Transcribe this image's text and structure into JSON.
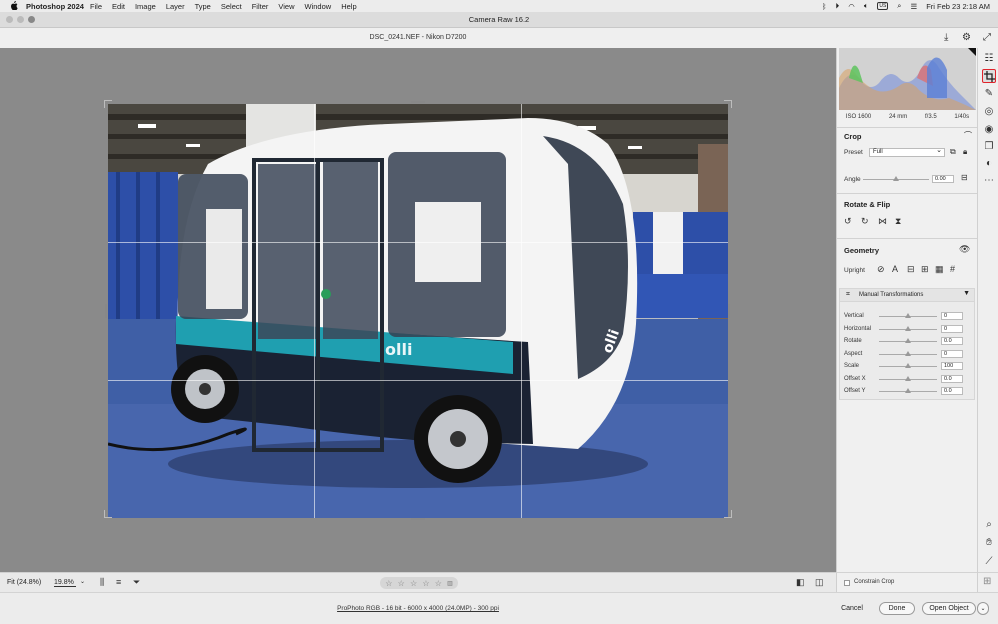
{
  "menubar": {
    "apple": "",
    "app_name": "Photoshop 2024",
    "items": [
      "File",
      "Edit",
      "Image",
      "Layer",
      "Type",
      "Select",
      "Filter",
      "View",
      "Window",
      "Help"
    ],
    "input_source": "US",
    "datetime": "Fri Feb 23  2:18 AM"
  },
  "window": {
    "title": "Camera Raw 16.2"
  },
  "filebar": {
    "filename": "DSC_0241.NEF  -  Nikon D7200"
  },
  "histogram": {
    "iso": "ISO 1600",
    "focal": "24 mm",
    "aperture": "f/3.5",
    "shutter": "1/40s",
    "colors": {
      "red": "#e06c6c",
      "green": "#5ec45e",
      "blue": "#5b7fd6",
      "yellow": "#d4c060"
    }
  },
  "crop": {
    "title": "Crop",
    "preset_label": "Preset",
    "preset_value": "Full",
    "angle_label": "Angle",
    "angle_value": "0.00",
    "angle_slider_position": 0.5
  },
  "rotate": {
    "title": "Rotate & Flip"
  },
  "geometry": {
    "title": "Geometry",
    "upright_label": "Upright",
    "manual_title": "Manual Transformations",
    "sliders": [
      {
        "label": "Vertical",
        "value": "0",
        "position": 0.5
      },
      {
        "label": "Horizontal",
        "value": "0",
        "position": 0.5
      },
      {
        "label": "Rotate",
        "value": "0.0",
        "position": 0.5
      },
      {
        "label": "Aspect",
        "value": "0",
        "position": 0.5
      },
      {
        "label": "Scale",
        "value": "100",
        "position": 0.5
      },
      {
        "label": "Offset X",
        "value": "0.0",
        "position": 0.5
      },
      {
        "label": "Offset Y",
        "value": "0.0",
        "position": 0.5
      }
    ]
  },
  "constrain_crop": {
    "label": "Constrain Crop"
  },
  "bottombar": {
    "fit_label": "Fit (24.8%)",
    "zoom_value": "19.8%"
  },
  "rating": {
    "stars": 0,
    "max_stars": 5
  },
  "statusbar": {
    "info": "ProPhoto RGB - 16 bit - 6000 x 4000 (24.0MP) - 300 ppi",
    "cancel": "Cancel",
    "done": "Done",
    "open": "Open Object"
  },
  "photo": {
    "vehicle_text": "olli"
  },
  "accent": "#e0232b"
}
